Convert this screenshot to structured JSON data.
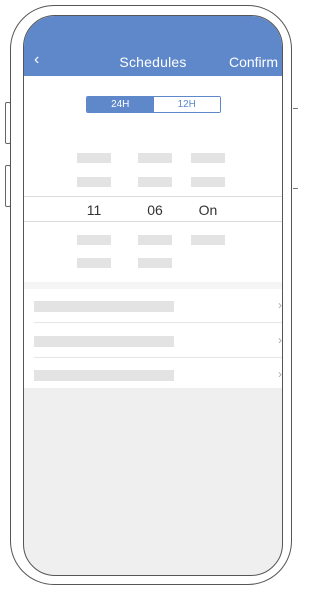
{
  "header": {
    "back_icon": "‹",
    "title": "Schedules",
    "confirm_label": "Confirm"
  },
  "time_format": {
    "options": [
      "24H",
      "12H"
    ],
    "selected": "24H"
  },
  "picker": {
    "hour": "11",
    "minute": "06",
    "state": "On"
  },
  "settings": {
    "chevron": "›",
    "rows": [
      "row-1",
      "row-2",
      "row-3"
    ]
  },
  "colors": {
    "accent": "#5f88cb",
    "placeholder": "#e3e3e3",
    "screen_bg": "#efefef"
  }
}
